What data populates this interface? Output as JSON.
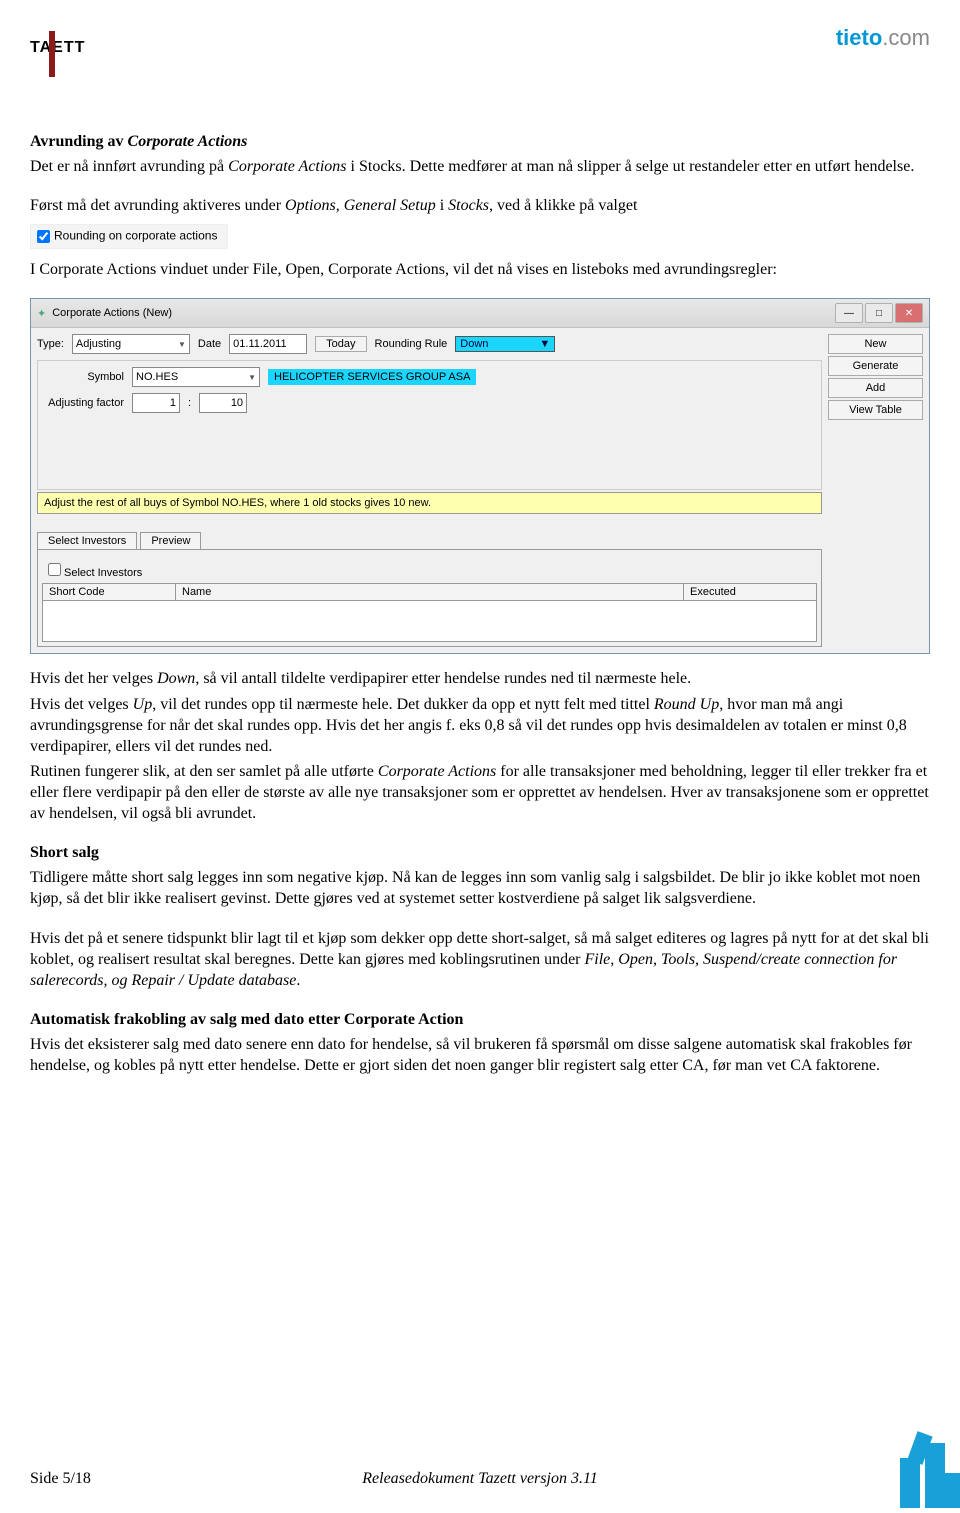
{
  "header": {
    "logo_left_a": "TA",
    "logo_left_b": "ETT",
    "logo_right_a": "tieto",
    "logo_right_b": ".com"
  },
  "sec1": {
    "title": "Avrunding av ",
    "title_i": "Corporate Actions",
    "p1a": "Det er nå innført avrunding på ",
    "p1b": "Corporate Actions",
    "p1c": " i Stocks. Dette medfører at man nå slipper å selge ut restandeler etter en utført hendelse.",
    "p2a": "Først må det avrunding aktiveres under ",
    "p2b": "Options, General Setup",
    "p2c": " i ",
    "p2d": "Stocks",
    "p2e": ", ved å klikke på valget",
    "chk": "Rounding on corporate actions",
    "p3a": "I Corporate Actions vinduet under File, Open, Corporate Actions, vil det nå vises en listeboks med avrundingsregler:"
  },
  "app": {
    "title": "Corporate Actions (New)",
    "buttons": {
      "new": "New",
      "generate": "Generate",
      "add": "Add",
      "view": "View Table"
    },
    "type_lbl": "Type:",
    "type_val": "Adjusting",
    "date_lbl": "Date",
    "date_val": "01.11.2011",
    "today": "Today",
    "rr_lbl": "Rounding Rule",
    "rr_val": "Down",
    "symbol_lbl": "Symbol",
    "symbol_val": "NO.HES",
    "company": "HELICOPTER SERVICES GROUP ASA",
    "adj_lbl": "Adjusting factor",
    "adj_a": "1",
    "adj_b": "10",
    "msg": "Adjust the rest of all buys of Symbol NO.HES, where 1 old stocks gives 10 new.",
    "tab1": "Select Investors",
    "tab2": "Preview",
    "sub_chk": "Select Investors",
    "col1": "Short Code",
    "col2": "Name",
    "col3": "Executed"
  },
  "sec2": {
    "p1a": "Hvis det her velges ",
    "p1b": "Down",
    "p1c": ", så vil antall tildelte verdipapirer etter hendelse rundes ned til nærmeste hele.",
    "p2a": "Hvis det velges ",
    "p2b": "Up",
    "p2c": ", vil det rundes opp til nærmeste hele. Det dukker da opp et nytt felt med tittel ",
    "p2d": "Round Up",
    "p2e": ", hvor man må angi avrundingsgrense for når det skal rundes opp. Hvis det her angis f. eks 0,8 så vil det rundes opp hvis desimaldelen av totalen er minst 0,8 verdipapirer, ellers vil det rundes ned.",
    "p3a": "Rutinen fungerer slik, at den ser samlet på alle utførte ",
    "p3b": "Corporate Actions",
    "p3c": " for alle transaksjoner med beholdning, legger til eller trekker fra et eller flere verdipapir på den eller de største av alle nye transaksjoner som er opprettet av hendelsen. Hver av transaksjonene som er opprettet av hendelsen, vil også bli avrundet."
  },
  "sec3": {
    "title": "Short salg",
    "p1": "Tidligere måtte short salg legges inn som negative kjøp. Nå kan de legges inn som vanlig salg i salgsbildet. De blir jo ikke koblet mot noen kjøp, så det blir ikke realisert gevinst. Dette gjøres ved at systemet setter kostverdiene på salget lik salgsverdiene.",
    "p2a": "Hvis det på et senere tidspunkt blir lagt til et kjøp som dekker opp dette short-salget, så må salget editeres og lagres på nytt for at det skal bli koblet, og realisert resultat skal beregnes. Dette kan gjøres med koblingsrutinen under ",
    "p2b": "File, Open, Tools, Suspend/create connection for salerecords, og Repair / Update database",
    "p2c": "."
  },
  "sec4": {
    "title": "Automatisk frakobling av salg med dato etter Corporate Action",
    "p1": "Hvis det eksisterer salg med dato senere enn dato for hendelse, så vil brukeren få spørsmål om disse salgene automatisk skal frakobles før hendelse, og kobles på nytt etter hendelse. Dette er gjort siden det noen ganger blir registert salg etter CA, før man vet CA faktorene."
  },
  "footer": {
    "left": "Side 5/18",
    "center": "Releasedokument Tazett versjon 3.11"
  }
}
